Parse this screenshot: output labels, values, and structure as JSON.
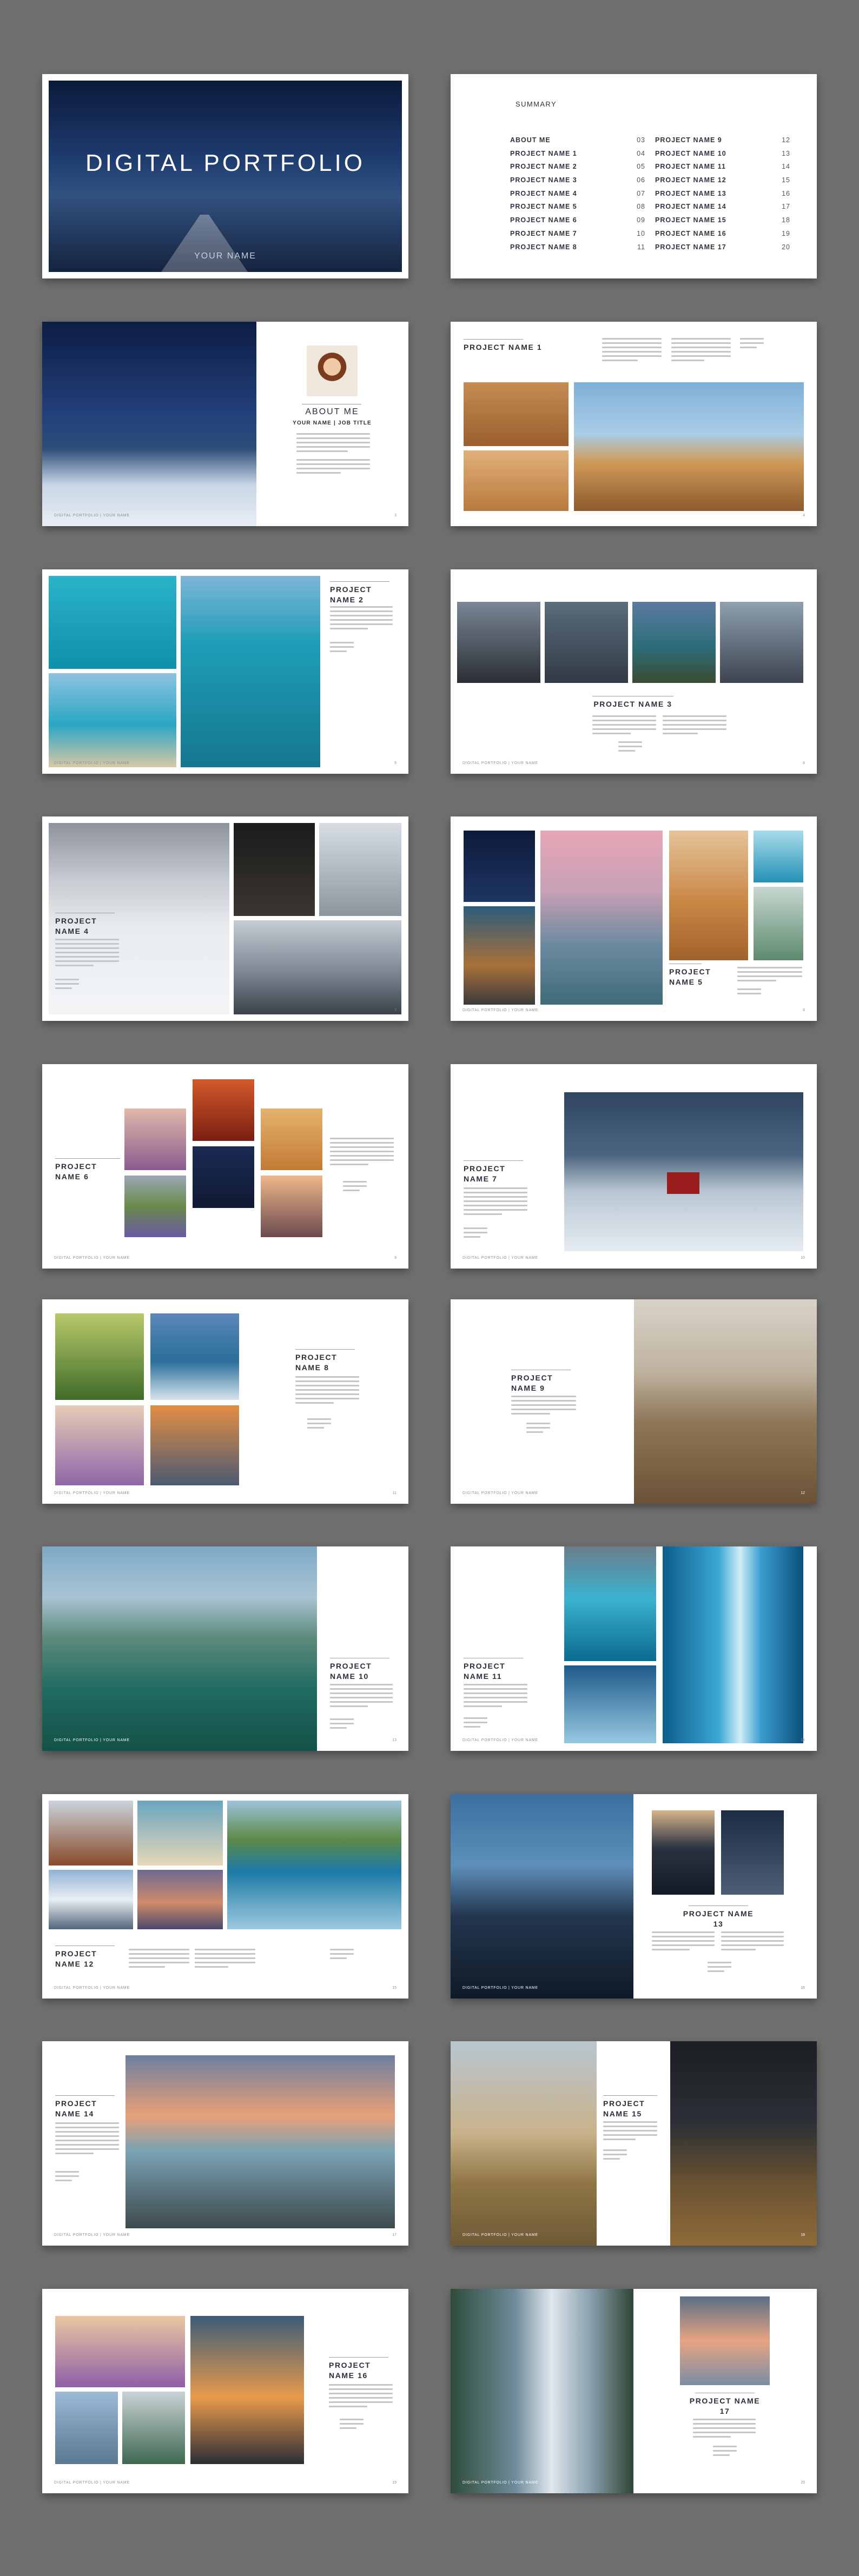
{
  "cover": {
    "title": "DIGITAL PORTFOLIO",
    "author": "YOUR NAME"
  },
  "summary": {
    "heading": "SUMMARY",
    "left": [
      {
        "label": "ABOUT ME",
        "page": "03"
      },
      {
        "label": "PROJECT NAME 1",
        "page": "04"
      },
      {
        "label": "PROJECT NAME 2",
        "page": "05"
      },
      {
        "label": "PROJECT NAME 3",
        "page": "06"
      },
      {
        "label": "PROJECT NAME 4",
        "page": "07"
      },
      {
        "label": "PROJECT NAME 5",
        "page": "08"
      },
      {
        "label": "PROJECT NAME 6",
        "page": "09"
      },
      {
        "label": "PROJECT NAME 7",
        "page": "10"
      },
      {
        "label": "PROJECT NAME 8",
        "page": "11"
      }
    ],
    "right": [
      {
        "label": "PROJECT NAME 9",
        "page": "12"
      },
      {
        "label": "PROJECT NAME 10",
        "page": "13"
      },
      {
        "label": "PROJECT NAME 11",
        "page": "14"
      },
      {
        "label": "PROJECT NAME 12",
        "page": "15"
      },
      {
        "label": "PROJECT NAME 13",
        "page": "16"
      },
      {
        "label": "PROJECT NAME 14",
        "page": "17"
      },
      {
        "label": "PROJECT NAME 15",
        "page": "18"
      },
      {
        "label": "PROJECT NAME 16",
        "page": "19"
      },
      {
        "label": "PROJECT NAME 17",
        "page": "20"
      }
    ]
  },
  "about": {
    "heading": "ABOUT ME",
    "subtitle": "YOUR NAME | JOB TITLE"
  },
  "footer": "DIGITAL PORTFOLIO | YOUR NAME",
  "projects": {
    "p1": "PROJECT NAME 1",
    "p2": "PROJECT NAME 2",
    "p3": "PROJECT NAME 3",
    "p4": "PROJECT NAME 4",
    "p5": "PROJECT NAME 5",
    "p6": "PROJECT NAME 6",
    "p7": "PROJECT NAME 7",
    "p8": "PROJECT NAME 8",
    "p9": "PROJECT NAME 9",
    "p10": "PROJECT NAME 10",
    "p11": "PROJECT NAME 11",
    "p12": "PROJECT NAME 12",
    "p13": "PROJECT NAME 13",
    "p14": "PROJECT NAME 14",
    "p15": "PROJECT NAME 15",
    "p16": "PROJECT NAME 16",
    "p17": "PROJECT NAME 17"
  },
  "page_numbers": [
    "3",
    "4",
    "5",
    "6",
    "7",
    "8",
    "9",
    "10",
    "11",
    "12",
    "13",
    "14",
    "15",
    "16",
    "17",
    "18",
    "19",
    "20"
  ]
}
